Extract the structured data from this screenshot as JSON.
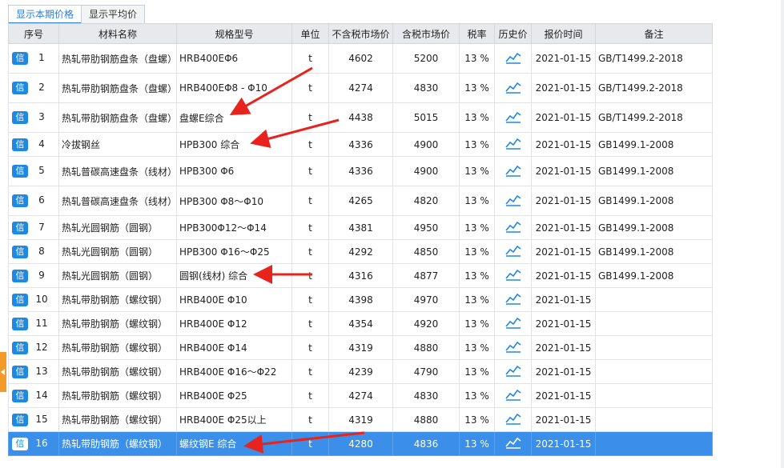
{
  "tabs": [
    "显示本期价格",
    "显示平均价"
  ],
  "columns": [
    "序号",
    "材料名称",
    "规格型号",
    "单位",
    "不含税市场价",
    "含税市场价",
    "税率",
    "历史价",
    "报价时间",
    "备注"
  ],
  "badge_label": "信",
  "history_icon": "trend-chart-icon",
  "selected_row": 16,
  "rows": [
    {
      "no": "1",
      "name": "热轧带肋钢筋盘条（盘螺）",
      "spec": "HRB400EΦ6",
      "unit": "t",
      "price_ex": "4602",
      "price_in": "5200",
      "tax": "13 %",
      "date": "2021-01-15",
      "note": "GB/T1499.2-2018"
    },
    {
      "no": "2",
      "name": "热轧带肋钢筋盘条（盘螺）",
      "spec": "HRB400EΦ8 - Φ10",
      "unit": "t",
      "price_ex": "4274",
      "price_in": "4830",
      "tax": "13 %",
      "date": "2021-01-15",
      "note": "GB/T1499.2-2018"
    },
    {
      "no": "3",
      "name": "热轧带肋钢筋盘条（盘螺）",
      "spec": "盘螺E综合",
      "unit": "t",
      "price_ex": "4438",
      "price_in": "5015",
      "tax": "13 %",
      "date": "2021-01-15",
      "note": "GB/T1499.2-2018"
    },
    {
      "no": "4",
      "name": "冷拔钢丝",
      "spec": "HPB300  综合",
      "unit": "t",
      "price_ex": "4336",
      "price_in": "4900",
      "tax": "13 %",
      "date": "2021-01-15",
      "note": "GB1499.1-2008"
    },
    {
      "no": "5",
      "name": "热轧普碳高速盘条（线材）",
      "spec": "HPB300  Φ6",
      "unit": "t",
      "price_ex": "4336",
      "price_in": "4900",
      "tax": "13 %",
      "date": "2021-01-15",
      "note": "GB1499.1-2008"
    },
    {
      "no": "6",
      "name": "热轧普碳高速盘条（线材）",
      "spec": "HPB300  Φ8～Φ10",
      "unit": "t",
      "price_ex": "4265",
      "price_in": "4820",
      "tax": "13 %",
      "date": "2021-01-15",
      "note": "GB1499.1-2008"
    },
    {
      "no": "7",
      "name": "热轧光圆钢筋（圆钢）",
      "spec": "HPB300Φ12～Φ14",
      "unit": "t",
      "price_ex": "4381",
      "price_in": "4950",
      "tax": "13 %",
      "date": "2021-01-15",
      "note": "GB1499.1-2008"
    },
    {
      "no": "8",
      "name": "热轧光圆钢筋（圆钢）",
      "spec": "HPB300  Φ16～Φ25",
      "unit": "t",
      "price_ex": "4292",
      "price_in": "4850",
      "tax": "13 %",
      "date": "2021-01-15",
      "note": "GB1499.1-2008"
    },
    {
      "no": "9",
      "name": "热轧光圆钢筋（圆钢）",
      "spec": "圆钢(线材)    综合",
      "unit": "t",
      "price_ex": "4316",
      "price_in": "4877",
      "tax": "13 %",
      "date": "2021-01-15",
      "note": "GB1499.1-2008"
    },
    {
      "no": "10",
      "name": "热轧带肋钢筋（螺纹钢）",
      "spec": "HRB400E  Φ10",
      "unit": "t",
      "price_ex": "4398",
      "price_in": "4970",
      "tax": "13 %",
      "date": "2021-01-15",
      "note": ""
    },
    {
      "no": "11",
      "name": "热轧带肋钢筋（螺纹钢）",
      "spec": "HRB400E  Φ12",
      "unit": "t",
      "price_ex": "4354",
      "price_in": "4920",
      "tax": "13 %",
      "date": "2021-01-15",
      "note": ""
    },
    {
      "no": "12",
      "name": "热轧带肋钢筋（螺纹钢）",
      "spec": "HRB400E  Φ14",
      "unit": "t",
      "price_ex": "4319",
      "price_in": "4880",
      "tax": "13 %",
      "date": "2021-01-15",
      "note": ""
    },
    {
      "no": "13",
      "name": "热轧带肋钢筋（螺纹钢）",
      "spec": "HRB400E  Φ16～Φ22",
      "unit": "t",
      "price_ex": "4239",
      "price_in": "4790",
      "tax": "13 %",
      "date": "2021-01-15",
      "note": ""
    },
    {
      "no": "14",
      "name": "热轧带肋钢筋（螺纹钢）",
      "spec": "HRB400E  Φ25",
      "unit": "t",
      "price_ex": "4274",
      "price_in": "4830",
      "tax": "13 %",
      "date": "2021-01-15",
      "note": ""
    },
    {
      "no": "15",
      "name": "热轧带肋钢筋（螺纹钢）",
      "spec": "HRB400E  Φ25以上",
      "unit": "t",
      "price_ex": "4319",
      "price_in": "4880",
      "tax": "13 %",
      "date": "2021-01-15",
      "note": ""
    },
    {
      "no": "16",
      "name": "热轧带肋钢筋（螺纹钢）",
      "spec": "螺纹钢E  综合",
      "unit": "t",
      "price_ex": "4280",
      "price_in": "4836",
      "tax": "13 %",
      "date": "2021-01-15",
      "note": ""
    }
  ],
  "colors": {
    "accent": "#2b7de0",
    "selected_row": "#3b8fe8",
    "badge": "#1e88e5",
    "annotation_arrow": "#e8231e",
    "side_tab": "#f39a28"
  }
}
